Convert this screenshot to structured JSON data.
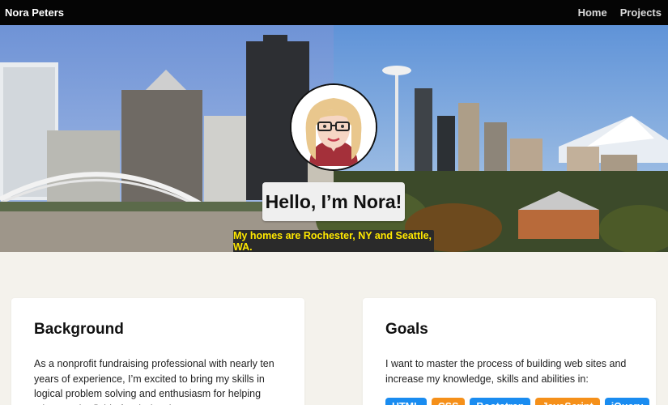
{
  "nav": {
    "brand": "Nora Peters",
    "links": [
      {
        "label": "Home"
      },
      {
        "label": "Projects"
      }
    ]
  },
  "hero": {
    "greeting": "Hello, I’m Nora!",
    "tagline": "My homes are Rochester, NY and Seattle, WA."
  },
  "background_card": {
    "title": "Background",
    "text": "As a nonprofit fundraising professional with nearly ten years of experience, I’m excited to bring my skills in logical problem solving and enthusiasm for helping others to the field of web development."
  },
  "goals_card": {
    "title": "Goals",
    "text": "I want to master the process of building web sites and increase my knowledge, skills and abilities in:",
    "skills": [
      {
        "label": "HTML",
        "color": "#1a8cf0"
      },
      {
        "label": "CSS",
        "color": "#f5901a"
      },
      {
        "label": "Bootstrap",
        "color": "#1a8cf0"
      },
      {
        "label": "JavaScript",
        "color": "#f5901a"
      },
      {
        "label": "jQuery",
        "color": "#1a8cf0"
      }
    ]
  }
}
